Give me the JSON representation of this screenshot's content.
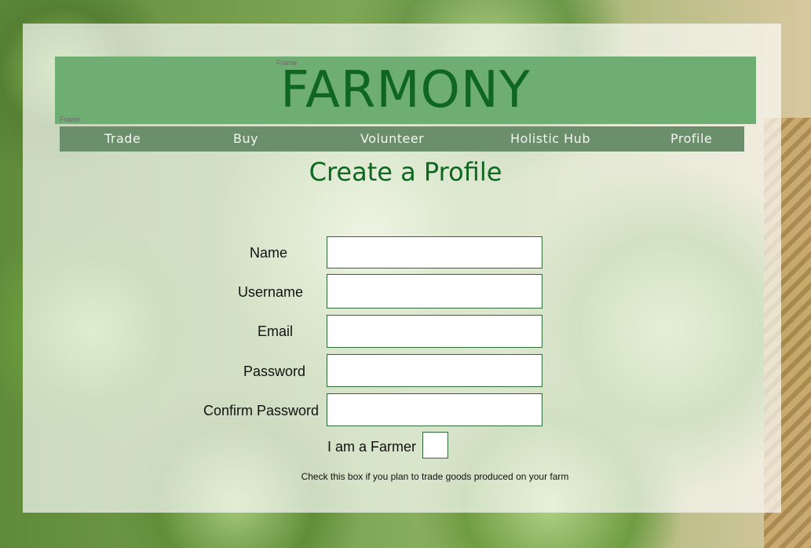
{
  "frame_label": "Frame",
  "brand": "FARMONY",
  "nav": {
    "items": [
      {
        "label": "Trade"
      },
      {
        "label": "Buy"
      },
      {
        "label": "Volunteer"
      },
      {
        "label": "Holistic Hub"
      },
      {
        "label": "Profile"
      }
    ]
  },
  "page_title": "Create a Profile",
  "form": {
    "name_label": "Name",
    "username_label": "Username",
    "email_label": "Email",
    "password_label": "Password",
    "confirm_password_label": "Confirm Password",
    "name_value": "",
    "username_value": "",
    "email_value": "",
    "password_value": "",
    "confirm_password_value": "",
    "farmer_label": "I am a Farmer",
    "farmer_checked": false,
    "farmer_hint": "Check this box if you plan to trade goods produced on your farm"
  },
  "colors": {
    "header_bg": "#6fae72",
    "brand_text": "#0e6620",
    "nav_bg": "#6b8f6b",
    "title_text": "#0e6620"
  }
}
